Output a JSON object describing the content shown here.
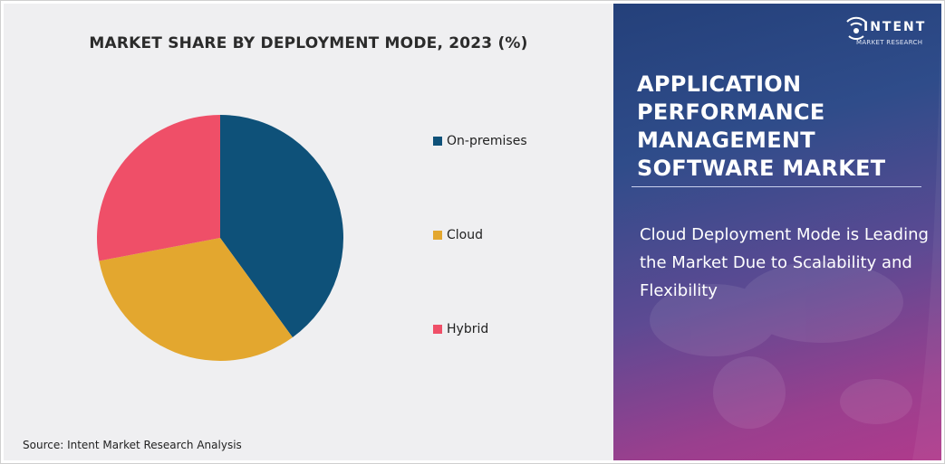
{
  "chart_data": {
    "type": "pie",
    "title": "MARKET SHARE BY DEPLOYMENT MODE, 2023 (%)",
    "labels": [
      "On-premises",
      "Cloud",
      "Hybrid"
    ],
    "values": [
      40,
      32,
      28
    ],
    "colors": [
      "#0e5179",
      "#e3a72f",
      "#ef4f68"
    ],
    "legend_position": "right"
  },
  "source": "Source: Intent Market Research Analysis",
  "panel": {
    "title": "APPLICATION PERFORMANCE MANAGEMENT SOFTWARE MARKET",
    "subtitle": "Cloud Deployment Mode is Leading the Market Due to Scalability and Flexibility"
  },
  "logo": {
    "name": "INTENT",
    "sub": "MARKET RESEARCH",
    "icon": "wifi-signal-icon"
  }
}
